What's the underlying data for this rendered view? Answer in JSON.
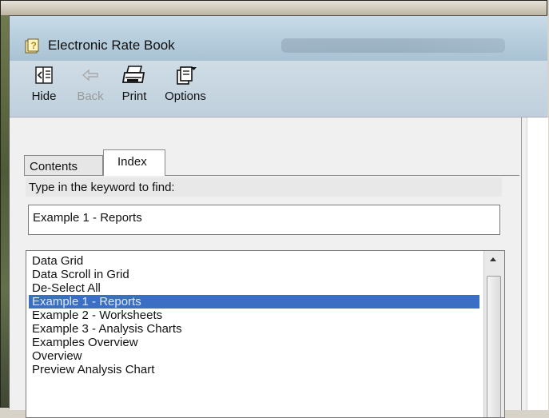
{
  "window": {
    "title": "Electronic Rate Book",
    "icon": "help-question-icon"
  },
  "toolbar": {
    "buttons": [
      {
        "label": "Hide",
        "icon": "hide-icon",
        "enabled": true
      },
      {
        "label": "Back",
        "icon": "back-arrow-icon",
        "enabled": false
      },
      {
        "label": "Print",
        "icon": "printer-icon",
        "enabled": true
      },
      {
        "label": "Options",
        "icon": "options-icon",
        "enabled": true
      }
    ]
  },
  "tabs": [
    {
      "label": "Contents",
      "selected": false
    },
    {
      "label": "Index",
      "selected": true
    }
  ],
  "index": {
    "prompt": "Type in the keyword to find:",
    "keyword": "Example 1 - Reports",
    "items": [
      "Data Grid",
      "Data Scroll in Grid",
      "De-Select All",
      "Example 1 - Reports",
      "Example 2 - Worksheets",
      "Example 3 - Analysis Charts",
      "Examples Overview",
      "Overview",
      "Preview Analysis Chart"
    ],
    "selected_item": "Example 1 - Reports"
  },
  "colors": {
    "selection": "#3a6fc4",
    "titlebar": "#b7cedd"
  }
}
